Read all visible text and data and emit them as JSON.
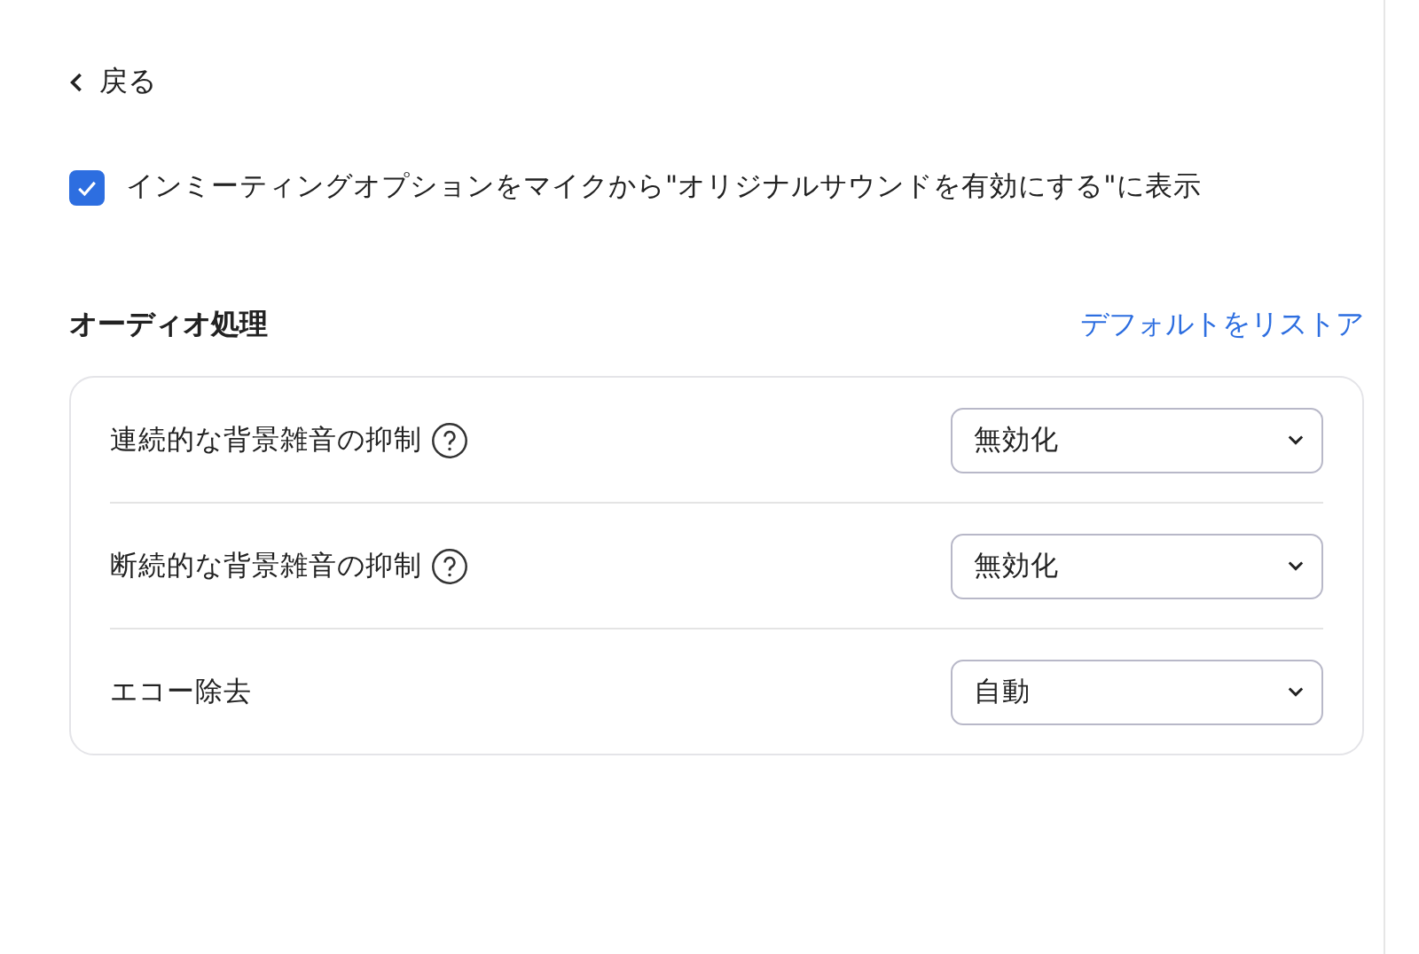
{
  "back": {
    "label": "戻る"
  },
  "option": {
    "label": "インミーティングオプションをマイクから\"オリジナルサウンドを有効にする\"に表示",
    "checked": true
  },
  "section": {
    "title": "オーディオ処理",
    "link": "デフォルトをリストア"
  },
  "rows": [
    {
      "label": "連続的な背景雑音の抑制",
      "help": true,
      "value": "無効化"
    },
    {
      "label": "断続的な背景雑音の抑制",
      "help": true,
      "value": "無効化"
    },
    {
      "label": "エコー除去",
      "help": false,
      "value": "自動"
    }
  ]
}
